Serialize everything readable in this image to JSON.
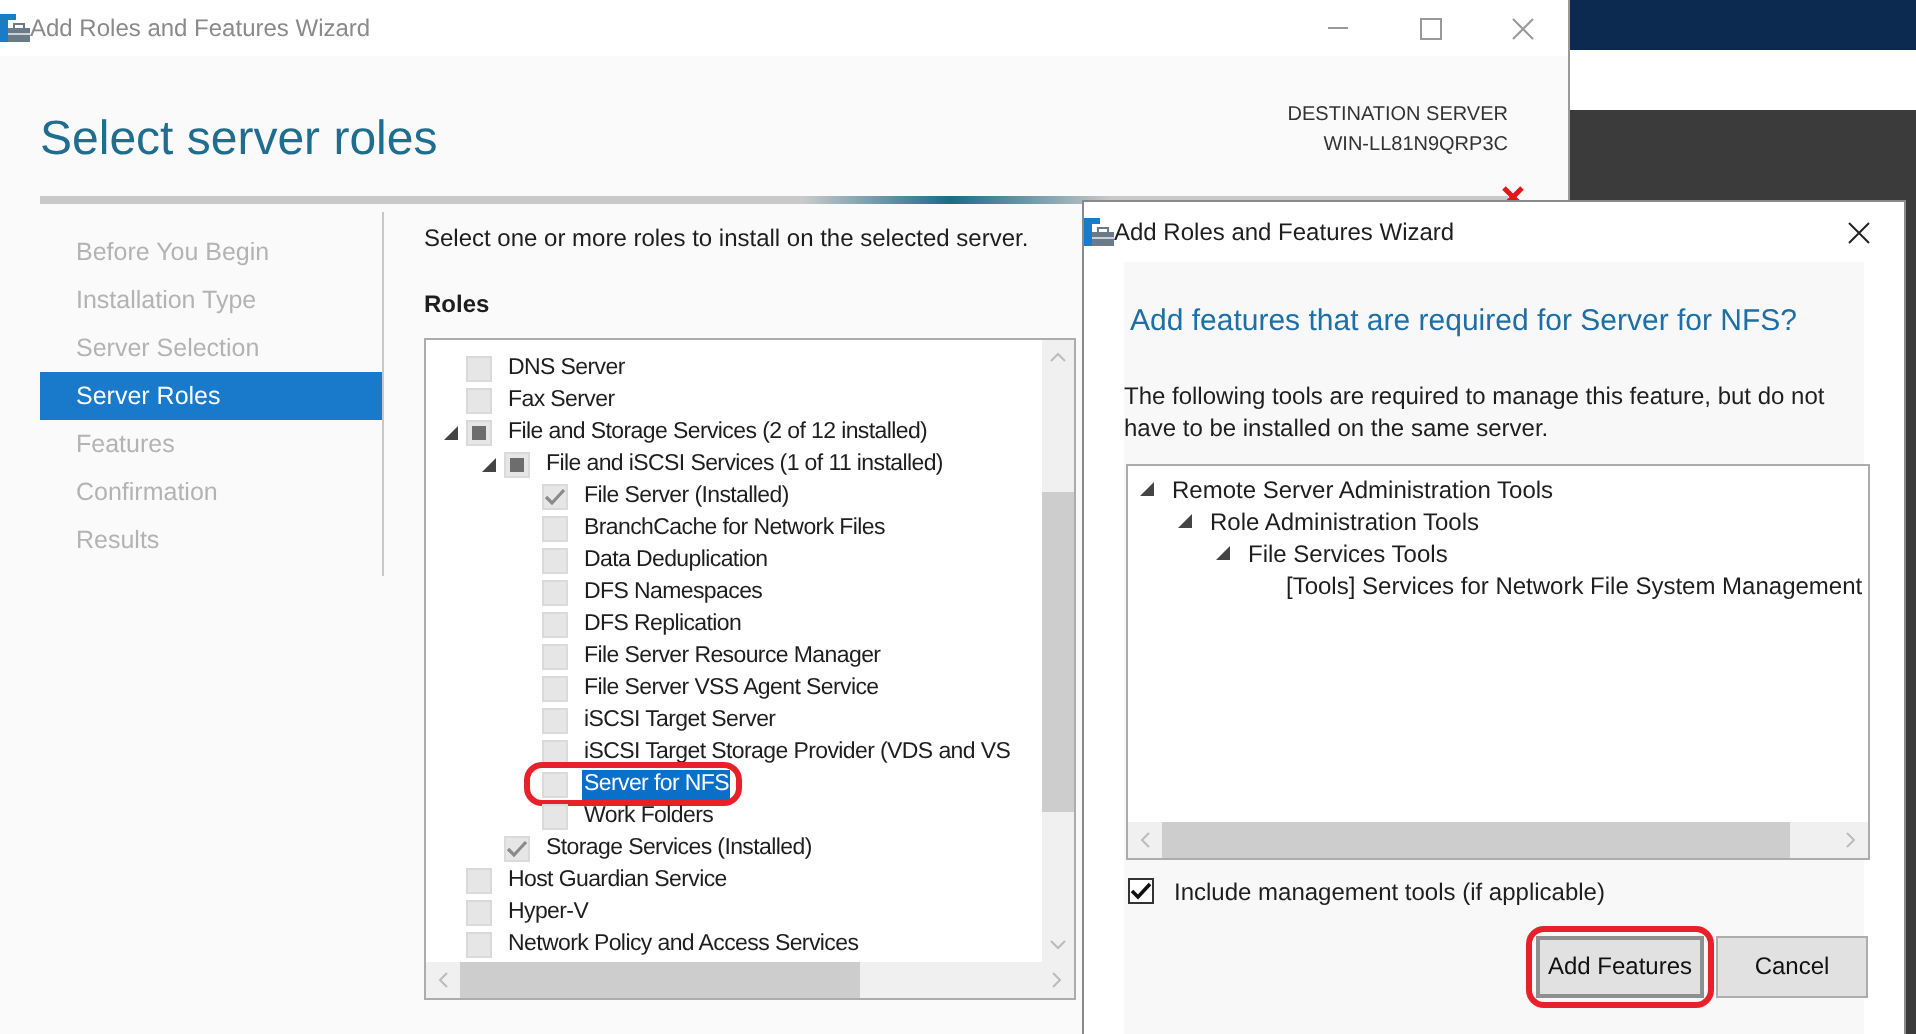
{
  "main_window": {
    "title": "Add Roles and Features Wizard",
    "page_title": "Select server roles",
    "destination_label": "DESTINATION SERVER",
    "destination_server": "WIN-LL81N9QRP3C",
    "steps": [
      {
        "label": "Before You Begin",
        "selected": false
      },
      {
        "label": "Installation Type",
        "selected": false
      },
      {
        "label": "Server Selection",
        "selected": false
      },
      {
        "label": "Server Roles",
        "selected": true
      },
      {
        "label": "Features",
        "selected": false
      },
      {
        "label": "Confirmation",
        "selected": false
      },
      {
        "label": "Results",
        "selected": false
      }
    ],
    "instruction": "Select one or more roles to install on the selected server.",
    "roles_heading": "Roles",
    "roles": [
      {
        "label": "DNS Server",
        "checked": false,
        "selected": false
      },
      {
        "label": "Fax Server",
        "checked": false,
        "selected": false
      },
      {
        "label": "File and Storage Services (2 of 12 installed)",
        "checked": false,
        "partial": true,
        "selected": false,
        "expanded": true,
        "children": [
          {
            "label": "File and iSCSI Services (1 of 11 installed)",
            "checked": false,
            "partial": true,
            "selected": false,
            "expanded": true,
            "children": [
              {
                "label": "File Server (Installed)",
                "checked": true,
                "selected": false
              },
              {
                "label": "BranchCache for Network Files",
                "checked": false,
                "selected": false
              },
              {
                "label": "Data Deduplication",
                "checked": false,
                "selected": false
              },
              {
                "label": "DFS Namespaces",
                "checked": false,
                "selected": false
              },
              {
                "label": "DFS Replication",
                "checked": false,
                "selected": false
              },
              {
                "label": "File Server Resource Manager",
                "checked": false,
                "selected": false
              },
              {
                "label": "File Server VSS Agent Service",
                "checked": false,
                "selected": false
              },
              {
                "label": "iSCSI Target Server",
                "checked": false,
                "selected": false
              },
              {
                "label": "iSCSI Target Storage Provider (VDS and VS",
                "checked": false,
                "selected": false
              },
              {
                "label": "Server for NFS",
                "checked": false,
                "selected": true,
                "annotated": true
              },
              {
                "label": "Work Folders",
                "checked": false,
                "selected": false
              }
            ]
          },
          {
            "label": "Storage Services (Installed)",
            "checked": true,
            "selected": false
          }
        ]
      },
      {
        "label": "Host Guardian Service",
        "checked": false,
        "selected": false
      },
      {
        "label": "Hyper-V",
        "checked": false,
        "selected": false
      },
      {
        "label": "Network Policy and Access Services",
        "checked": false,
        "selected": false
      }
    ]
  },
  "dialog": {
    "title": "Add Roles and Features Wizard",
    "heading": "Add features that are required for Server for NFS?",
    "description": "The following tools are required to manage this feature, but do not have to be installed on the same server.",
    "features": [
      {
        "label": "Remote Server Administration Tools",
        "expanded": true,
        "children": [
          {
            "label": "Role Administration Tools",
            "expanded": true,
            "children": [
              {
                "label": "File Services Tools",
                "expanded": true,
                "children": [
                  {
                    "label": "[Tools] Services for Network File System Management"
                  }
                ]
              }
            ]
          }
        ]
      }
    ],
    "include_tools": {
      "label": "Include management tools (if applicable)",
      "checked": true
    },
    "buttons": [
      {
        "label": "Add Features",
        "annotated": true
      },
      {
        "label": "Cancel",
        "annotated": false
      }
    ]
  }
}
